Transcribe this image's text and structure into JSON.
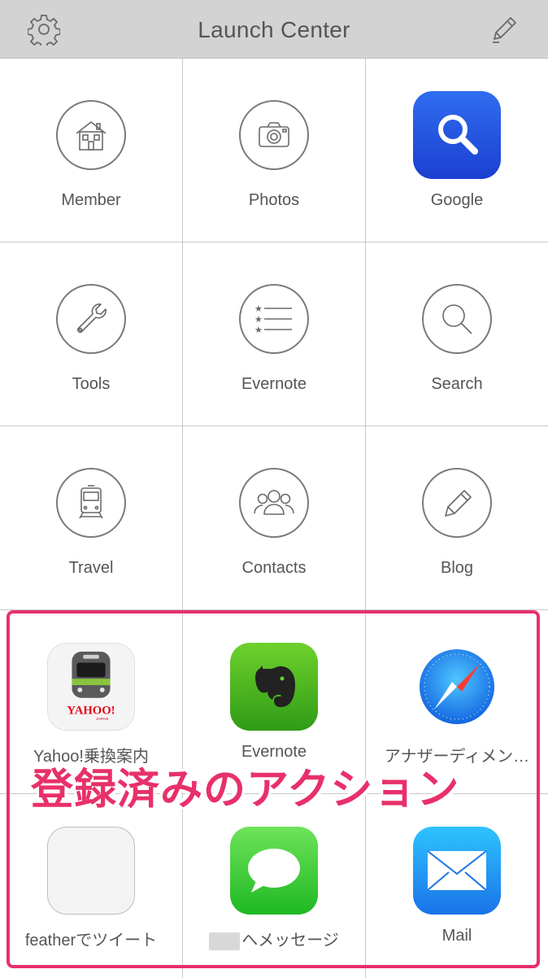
{
  "navbar": {
    "title": "Launch Center",
    "left_icon": "gear-icon",
    "right_icon": "pencil-icon"
  },
  "cells": [
    {
      "label": "Member",
      "icon": "house-icon"
    },
    {
      "label": "Photos",
      "icon": "camera-icon"
    },
    {
      "label": "Google",
      "icon": "google-search-app-icon"
    },
    {
      "label": "Tools",
      "icon": "wrench-icon"
    },
    {
      "label": "Evernote",
      "icon": "list-icon"
    },
    {
      "label": "Search",
      "icon": "magnifier-icon"
    },
    {
      "label": "Travel",
      "icon": "train-icon"
    },
    {
      "label": "Contacts",
      "icon": "people-icon"
    },
    {
      "label": "Blog",
      "icon": "pencil-icon"
    },
    {
      "label": "Yahoo!乗換案内",
      "icon": "yahoo-transit-app-icon"
    },
    {
      "label": "Evernote",
      "icon": "evernote-app-icon"
    },
    {
      "label": "アナザーディメン…",
      "icon": "safari-app-icon"
    },
    {
      "label": "featherでツイート",
      "icon": "feather-app-icon"
    },
    {
      "label": "へメッセージ",
      "icon": "messages-app-icon"
    },
    {
      "label": "Mail",
      "icon": "mail-app-icon"
    }
  ],
  "annotation": "登録済みのアクション",
  "yahoo_logo": {
    "main": "YAHOO!",
    "sub": "JAPAN"
  },
  "colors": {
    "accent": "#e8306a",
    "navbar": "#d3d3d3"
  }
}
